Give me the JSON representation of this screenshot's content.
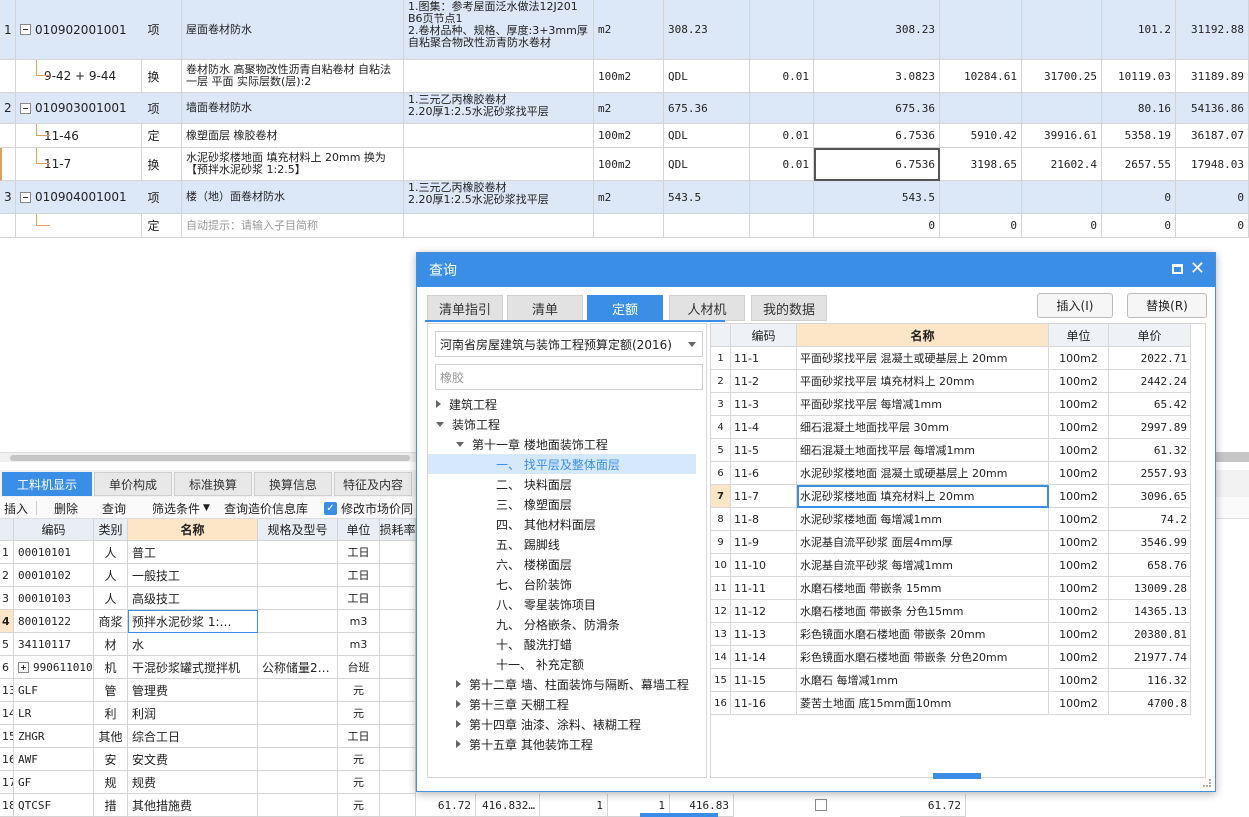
{
  "top_rows": [
    {
      "no": "1",
      "code": "010902001001",
      "type": "项",
      "name": "屋面卷材防水",
      "feature": "1.图集：参考屋面泛水做法12J201 B6页节点1\n2.卷材品种、规格、厚度:3+3mm厚自粘聚合物改性沥青防水卷材",
      "unit": "m2",
      "qty_expr": "308.23",
      "content": "",
      "qty": "308.23",
      "c1": "",
      "c2": "",
      "c3": "101.2",
      "c4": "31192.88"
    },
    {
      "no": "",
      "code": "9-42 + 9-44",
      "type": "换",
      "name": "卷材防水 高聚物改性沥青自粘卷材 自粘法一层 平面  实际层数(层):2",
      "feature": "",
      "unit": "100m2",
      "qty_expr": "QDL",
      "content": "0.01",
      "qty": "3.0823",
      "c1": "10284.61",
      "c2": "31700.25",
      "c3": "10119.03",
      "c4": "31189.89"
    },
    {
      "no": "2",
      "code": "010903001001",
      "type": "项",
      "name": "墙面卷材防水",
      "feature": "1.三元乙丙橡胶卷材\n2.20厚1:2.5水泥砂浆找平层",
      "unit": "m2",
      "qty_expr": "675.36",
      "content": "",
      "qty": "675.36",
      "c1": "",
      "c2": "",
      "c3": "80.16",
      "c4": "54136.86"
    },
    {
      "no": "",
      "code": "11-46",
      "type": "定",
      "name": "橡塑面层 橡胶卷材",
      "feature": "",
      "unit": "100m2",
      "qty_expr": "QDL",
      "content": "0.01",
      "qty": "6.7536",
      "c1": "5910.42",
      "c2": "39916.61",
      "c3": "5358.19",
      "c4": "36187.07"
    },
    {
      "no": "",
      "code": "11-7",
      "type": "换",
      "name": "水泥砂浆楼地面 填充材料上 20mm  换为【预拌水泥砂浆 1:2.5】",
      "feature": "",
      "unit": "100m2",
      "qty_expr": "QDL",
      "content": "0.01",
      "qty": "6.7536",
      "c1": "3198.65",
      "c2": "21602.4",
      "c3": "2657.55",
      "c4": "17948.03"
    },
    {
      "no": "3",
      "code": "010904001001",
      "type": "项",
      "name": "楼（地）面卷材防水",
      "feature": "1.三元乙丙橡胶卷材\n2.20厚1:2.5水泥砂浆找平层",
      "unit": "m2",
      "qty_expr": "543.5",
      "content": "",
      "qty": "543.5",
      "c1": "",
      "c2": "",
      "c3": "0",
      "c4": "0"
    },
    {
      "no": "",
      "code": "",
      "type": "定",
      "name": "自动提示：请输入子目简称",
      "feature": "",
      "unit": "",
      "qty_expr": "",
      "content": "",
      "qty": "0",
      "c1": "0",
      "c2": "0",
      "c3": "0",
      "c4": "0"
    }
  ],
  "bottom": {
    "tabs": [
      "工料机显示",
      "单价构成",
      "标准换算",
      "换算信息",
      "特征及内容"
    ],
    "toolbar": {
      "insert": "插入",
      "delete": "删除",
      "query": "查询",
      "filter": "筛选条件",
      "query_price": "查询造价信息库",
      "modify_market": "修改市场价同"
    },
    "headers": [
      "编码",
      "类别",
      "名称",
      "规格及型号",
      "单位",
      "损耗率"
    ],
    "rows": [
      {
        "no": "1",
        "code": "00010101",
        "cat": "人",
        "name": "普工",
        "spec": "",
        "unit": "工日"
      },
      {
        "no": "2",
        "code": "00010102",
        "cat": "人",
        "name": "一般技工",
        "spec": "",
        "unit": "工日"
      },
      {
        "no": "3",
        "code": "00010103",
        "cat": "人",
        "name": "高级技工",
        "spec": "",
        "unit": "工日"
      },
      {
        "no": "4",
        "code": "80010122",
        "cat": "商浆",
        "name": "预拌水泥砂浆 1:…",
        "spec": "",
        "unit": "m3"
      },
      {
        "no": "5",
        "code": "34110117",
        "cat": "材",
        "name": "水",
        "spec": "",
        "unit": "m3"
      },
      {
        "no": "6",
        "code": "990611010",
        "cat": "机",
        "name": "干混砂浆罐式搅拌机",
        "spec": "公称储量2…",
        "unit": "台班"
      },
      {
        "no": "13",
        "code": "GLF",
        "cat": "管",
        "name": "管理费",
        "spec": "",
        "unit": "元"
      },
      {
        "no": "14",
        "code": "LR",
        "cat": "利",
        "name": "利润",
        "spec": "",
        "unit": "元"
      },
      {
        "no": "15",
        "code": "ZHGR",
        "cat": "其他",
        "name": "综合工日",
        "spec": "",
        "unit": "工日"
      },
      {
        "no": "16",
        "code": "AWF",
        "cat": "安",
        "name": "安文费",
        "spec": "",
        "unit": "元"
      },
      {
        "no": "17",
        "code": "GF",
        "cat": "规",
        "name": "规费",
        "spec": "",
        "unit": "元"
      },
      {
        "no": "18",
        "code": "QTCSF",
        "cat": "措",
        "name": "其他措施费",
        "spec": "",
        "unit": "元"
      }
    ],
    "last_row_extra": {
      "a": "61.72",
      "b": "416.832…",
      "c": "1",
      "d": "1",
      "e": "416.83",
      "f": "61.72"
    }
  },
  "dialog": {
    "title": "查询",
    "tabs": [
      "清单指引",
      "清单",
      "定额",
      "人材机",
      "我的数据"
    ],
    "insert_btn": "插入(I)",
    "replace_btn": "替换(R)",
    "quota_lib": "河南省房屋建筑与装饰工程预算定额(2016)",
    "search_value": "橡胶",
    "tree": [
      {
        "label": "建筑工程",
        "level": 0,
        "arrow": "right"
      },
      {
        "label": "装饰工程",
        "level": 0,
        "arrow": "down"
      },
      {
        "label": "第十一章 楼地面装饰工程",
        "level": 1,
        "arrow": "down"
      },
      {
        "label": "一、 找平层及整体面层",
        "level": 2,
        "arrow": "",
        "selected": true
      },
      {
        "label": "二、 块料面层",
        "level": 2,
        "arrow": ""
      },
      {
        "label": "三、 橡塑面层",
        "level": 2,
        "arrow": ""
      },
      {
        "label": "四、 其他材料面层",
        "level": 2,
        "arrow": ""
      },
      {
        "label": "五、 踢脚线",
        "level": 2,
        "arrow": ""
      },
      {
        "label": "六、 楼梯面层",
        "level": 2,
        "arrow": ""
      },
      {
        "label": "七、 台阶装饰",
        "level": 2,
        "arrow": ""
      },
      {
        "label": "八、 零星装饰项目",
        "level": 2,
        "arrow": ""
      },
      {
        "label": "九、 分格嵌条、防滑条",
        "level": 2,
        "arrow": ""
      },
      {
        "label": "十、 酸洗打蜡",
        "level": 2,
        "arrow": ""
      },
      {
        "label": "十一、 补充定额",
        "level": 2,
        "arrow": ""
      },
      {
        "label": "第十二章 墙、柱面装饰与隔断、幕墙工程",
        "level": 1,
        "arrow": "right"
      },
      {
        "label": "第十三章 天棚工程",
        "level": 1,
        "arrow": "right"
      },
      {
        "label": "第十四章 油漆、涂料、裱糊工程",
        "level": 1,
        "arrow": "right"
      },
      {
        "label": "第十五章 其他装饰工程",
        "level": 1,
        "arrow": "right"
      }
    ],
    "headers": [
      "编码",
      "名称",
      "单位",
      "单价"
    ],
    "rows": [
      {
        "no": "1",
        "code": "11-1",
        "name": "平面砂浆找平层 混凝土或硬基层上 20mm",
        "unit": "100m2",
        "price": "2022.71"
      },
      {
        "no": "2",
        "code": "11-2",
        "name": "平面砂浆找平层 填充材料上 20mm",
        "unit": "100m2",
        "price": "2442.24"
      },
      {
        "no": "3",
        "code": "11-3",
        "name": "平面砂浆找平层 每增减1mm",
        "unit": "100m2",
        "price": "65.42"
      },
      {
        "no": "4",
        "code": "11-4",
        "name": "细石混凝土地面找平层 30mm",
        "unit": "100m2",
        "price": "2997.89"
      },
      {
        "no": "5",
        "code": "11-5",
        "name": "细石混凝土地面找平层 每增减1mm",
        "unit": "100m2",
        "price": "61.32"
      },
      {
        "no": "6",
        "code": "11-6",
        "name": "水泥砂浆楼地面 混凝土或硬基层上 20mm",
        "unit": "100m2",
        "price": "2557.93"
      },
      {
        "no": "7",
        "code": "11-7",
        "name": "水泥砂浆楼地面 填充材料上 20mm",
        "unit": "100m2",
        "price": "3096.65"
      },
      {
        "no": "8",
        "code": "11-8",
        "name": "水泥砂浆楼地面 每增减1mm",
        "unit": "100m2",
        "price": "74.2"
      },
      {
        "no": "9",
        "code": "11-9",
        "name": "水泥基自流平砂浆 面层4mm厚",
        "unit": "100m2",
        "price": "3546.99"
      },
      {
        "no": "10",
        "code": "11-10",
        "name": "水泥基自流平砂浆 每增减1mm",
        "unit": "100m2",
        "price": "658.76"
      },
      {
        "no": "11",
        "code": "11-11",
        "name": "水磨石楼地面 带嵌条 15mm",
        "unit": "100m2",
        "price": "13009.28"
      },
      {
        "no": "12",
        "code": "11-12",
        "name": "水磨石楼地面 带嵌条 分色15mm",
        "unit": "100m2",
        "price": "14365.13"
      },
      {
        "no": "13",
        "code": "11-13",
        "name": "彩色镜面水磨石楼地面 带嵌条 20mm",
        "unit": "100m2",
        "price": "20380.81"
      },
      {
        "no": "14",
        "code": "11-14",
        "name": "彩色镜面水磨石楼地面 带嵌条 分色20mm",
        "unit": "100m2",
        "price": "21977.74"
      },
      {
        "no": "15",
        "code": "11-15",
        "name": "水磨石 每增减1mm",
        "unit": "100m2",
        "price": "116.32"
      },
      {
        "no": "16",
        "code": "11-16",
        "name": "菱苦土地面 底15mm面10mm",
        "unit": "100m2",
        "price": "4700.8"
      }
    ]
  },
  "colors": {
    "accent": "#3a8ee6",
    "row_blue": "#dce8f8",
    "header_orange": "#fde6c8"
  }
}
